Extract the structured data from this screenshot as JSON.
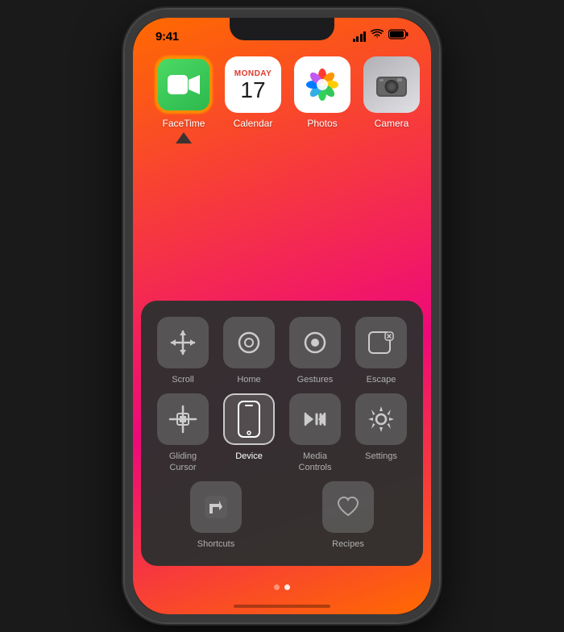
{
  "phone": {
    "status_bar": {
      "time": "9:41"
    },
    "home_screen": {
      "apps": [
        {
          "id": "facetime",
          "label": "FaceTime",
          "highlighted": true
        },
        {
          "id": "calendar",
          "label": "Calendar",
          "month": "Monday",
          "day": "17"
        },
        {
          "id": "photos",
          "label": "Photos"
        },
        {
          "id": "camera",
          "label": "Camera"
        }
      ]
    },
    "assistive_menu": {
      "rows": [
        [
          {
            "id": "scroll",
            "label": "Scroll",
            "icon": "scroll"
          },
          {
            "id": "home",
            "label": "Home",
            "icon": "home"
          },
          {
            "id": "gestures",
            "label": "Gestures",
            "icon": "gestures"
          },
          {
            "id": "escape",
            "label": "Escape",
            "icon": "escape"
          }
        ],
        [
          {
            "id": "gliding-cursor",
            "label": "Gliding\nCursor",
            "icon": "gliding"
          },
          {
            "id": "device",
            "label": "Device",
            "icon": "device",
            "highlighted": true
          },
          {
            "id": "media-controls",
            "label": "Media\nControls",
            "icon": "media"
          },
          {
            "id": "settings",
            "label": "Settings",
            "icon": "settings"
          }
        ],
        [
          {
            "id": "shortcuts",
            "label": "Shortcuts",
            "icon": "shortcuts"
          },
          {
            "id": "recipes",
            "label": "Recipes",
            "icon": "recipes"
          }
        ]
      ]
    },
    "page_dots": [
      {
        "active": false
      },
      {
        "active": true
      }
    ]
  }
}
